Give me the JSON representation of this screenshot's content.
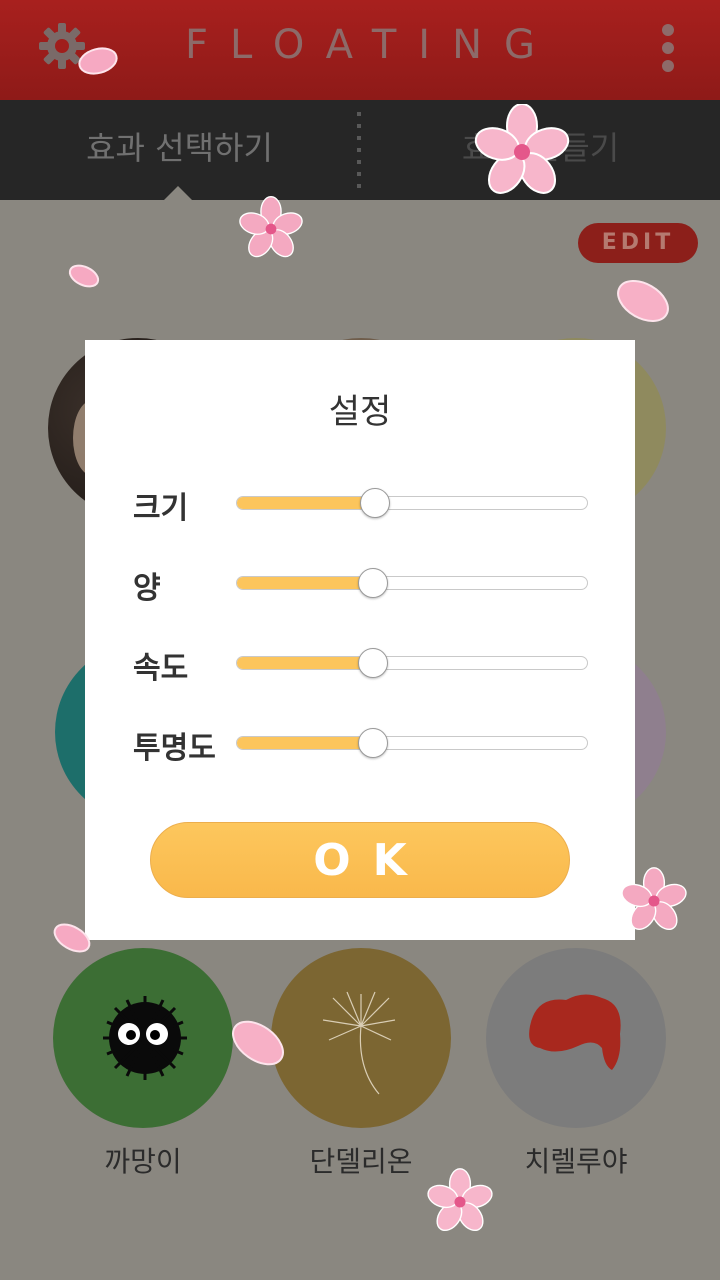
{
  "header": {
    "title": "FLOATING"
  },
  "tabs": [
    {
      "label": "효과 선택하기",
      "selected": true
    },
    {
      "label": "효과 만들기",
      "selected": false
    }
  ],
  "edit_label": "EDIT",
  "effects": [
    {
      "name": "까망이",
      "icon": "soot-sprite-icon"
    },
    {
      "name": "단델리온",
      "icon": "dandelion-icon"
    },
    {
      "name": "치렐루야",
      "icon": "red-flake-icon"
    }
  ],
  "dialog": {
    "title": "설정",
    "settings": [
      {
        "label": "크기",
        "value": 0.39
      },
      {
        "label": "양",
        "value": 0.385
      },
      {
        "label": "속도",
        "value": 0.385
      },
      {
        "label": "투명도",
        "value": 0.385
      }
    ],
    "ok_label": "OK"
  },
  "colors": {
    "header_red": "#a8201e",
    "slider_fill": "#fcc55c",
    "ok_button": "#fdc75d",
    "backdrop": "#8a8780"
  }
}
